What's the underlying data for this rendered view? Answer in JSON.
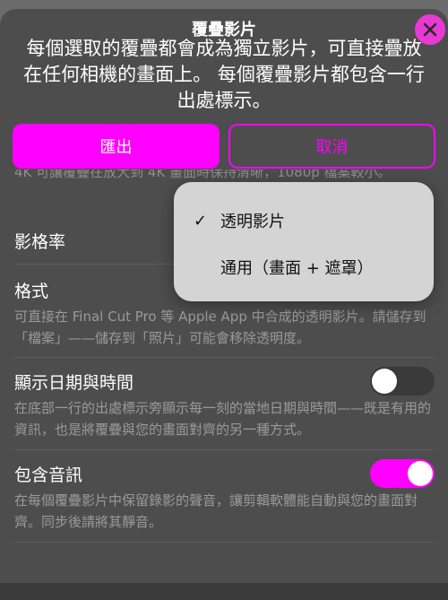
{
  "header": {
    "title": "覆疊影片",
    "description": "每個選取的覆疊都會成為獨立影片，可直接疊放在任何相機的畫面上。 每個覆疊影片都包含一行出處標示。",
    "close_icon": "close-icon"
  },
  "actions": {
    "export_label": "匯出",
    "cancel_label": "取消"
  },
  "colors": {
    "accent": "#ff00ff",
    "sheet": "#4d4d4d"
  },
  "settings": {
    "partial_note": "4K 可讓覆疊在放大到 4K 畫面時保持清晰，1080p 檔案較小。",
    "frame_rate_label": "影格率",
    "format_label": "格式",
    "format_note": "可直接在 Final Cut Pro 等 Apple App 中合成的透明影片。請儲存到「檔案」——儲存到「照片」可能會移除透明度。",
    "datetime_label": "顯示日期與時間",
    "datetime_note": "在底部一行的出處標示旁顯示每一刻的當地日期與時間——既是有用的資訊，也是將覆疊與您的畫面對齊的另一種方式。",
    "datetime_enabled": false,
    "audio_label": "包含音訊",
    "audio_note": "在每個覆疊影片中保留錄影的聲音，讓剪輯軟體能自動與您的畫面對齊。同步後請將其靜音。",
    "audio_enabled": true
  },
  "format_menu": {
    "selected_mark": "✓",
    "options": [
      {
        "label": "透明影片",
        "selected": true
      },
      {
        "label": "通用（畫面 + 遮罩）",
        "selected": false
      }
    ]
  }
}
